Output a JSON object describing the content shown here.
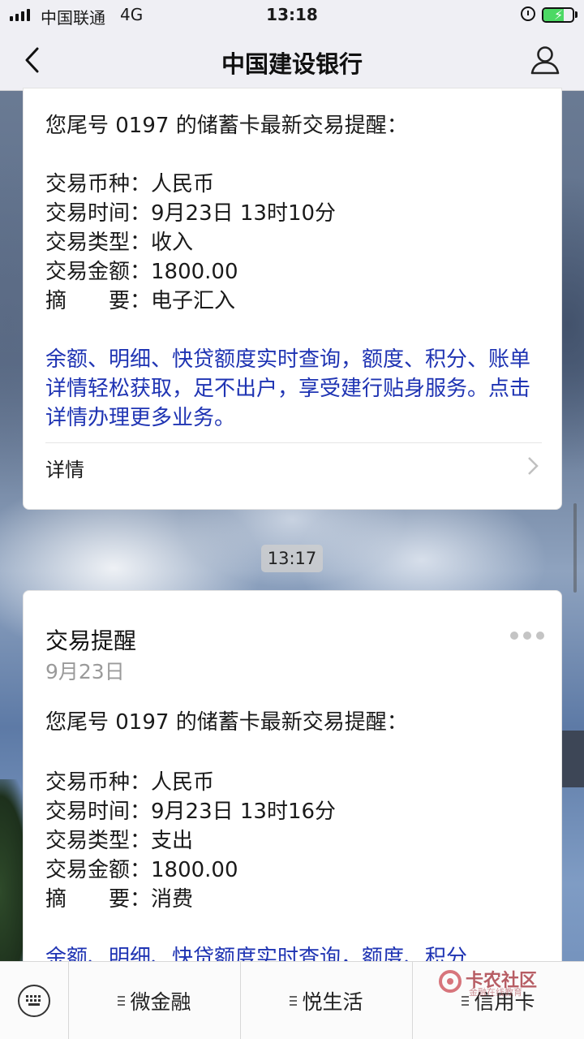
{
  "status_bar": {
    "carrier": "中国联通",
    "network": "4G",
    "time": "13:18",
    "battery_level": 0.7
  },
  "nav": {
    "title": "中国建设银行",
    "back_icon": "chevron-left-icon",
    "user_icon": "user-icon"
  },
  "message1": {
    "intro": "您尾号 0197 的储蓄卡最新交易提醒：",
    "currency": "交易币种：人民币",
    "time": "交易时间：9月23日 13时10分",
    "type": "交易类型：收入",
    "amount": "交易金额：1800.00",
    "summary": "摘　　要：电子汇入",
    "promo": "余额、明细、快贷额度实时查询，额度、积分、账单详情轻松获取，足不出户，享受建行贴身服务。点击详情办理更多业务。",
    "detail_label": "详情"
  },
  "timestamp": "13:17",
  "message2": {
    "title": "交易提醒",
    "date": "9月23日",
    "intro": "您尾号 0197 的储蓄卡最新交易提醒：",
    "currency": "交易币种：人民币",
    "time": "交易时间：9月23日 13时16分",
    "type": "交易类型：支出",
    "amount": "交易金额：1800.00",
    "summary": "摘　　要：消费",
    "promo": "余额、明细、快贷额度实时查询，额度、积分"
  },
  "menu": {
    "keyboard_icon": "keyboard-icon",
    "items": [
      "微金融",
      "悦生活",
      "信用卡"
    ]
  },
  "watermark": {
    "text": "卡农社区",
    "sub": "金融在线教育"
  },
  "colors": {
    "promo_text": "#1f34b3",
    "battery": "#4cd964"
  }
}
